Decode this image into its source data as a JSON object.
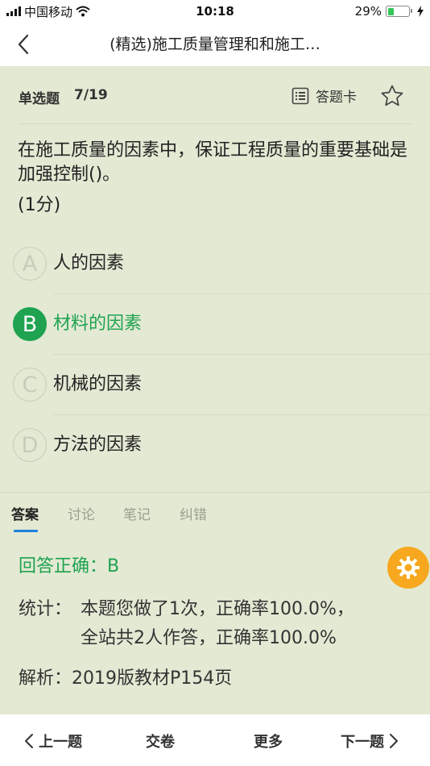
{
  "status_bar": {
    "carrier": "中国移动",
    "time": "10:18",
    "battery_percent": "29%",
    "battery_level": 0.29,
    "icons": [
      "signal-icon",
      "wifi-icon",
      "battery-icon",
      "charging-icon"
    ]
  },
  "nav": {
    "title": "(精选)施工质量管理和和施工…",
    "back_icon": "chevron-left-icon"
  },
  "question": {
    "type": "单选题",
    "progress": "7/19",
    "answer_card_label": "答题卡",
    "text": "在施工质量的因素中，保证工程质量的重要基础是加强控制()。",
    "score": "(1分)",
    "options": [
      {
        "letter": "A",
        "text": "人的因素",
        "selected": false
      },
      {
        "letter": "B",
        "text": "材料的因素",
        "selected": true
      },
      {
        "letter": "C",
        "text": "机械的因素",
        "selected": false
      },
      {
        "letter": "D",
        "text": "方法的因素",
        "selected": false
      }
    ]
  },
  "tabs": [
    "答案",
    "讨论",
    "笔记",
    "纠错"
  ],
  "answer": {
    "result": "回答正确：B",
    "stats_label": "统计：",
    "stats_line1": "本题您做了1次，正确率100.0%，",
    "stats_line2": "全站共2人作答，正确率100.0%",
    "analysis": "解析：2019版教材P154页"
  },
  "bottom_bar": {
    "prev": "上一题",
    "submit": "交卷",
    "more": "更多",
    "next": "下一题"
  },
  "colors": {
    "background": "#e3e9d3",
    "accent_green": "#1fa350",
    "tab_indicator": "#1f7fe0",
    "fab": "#f7a81f"
  }
}
